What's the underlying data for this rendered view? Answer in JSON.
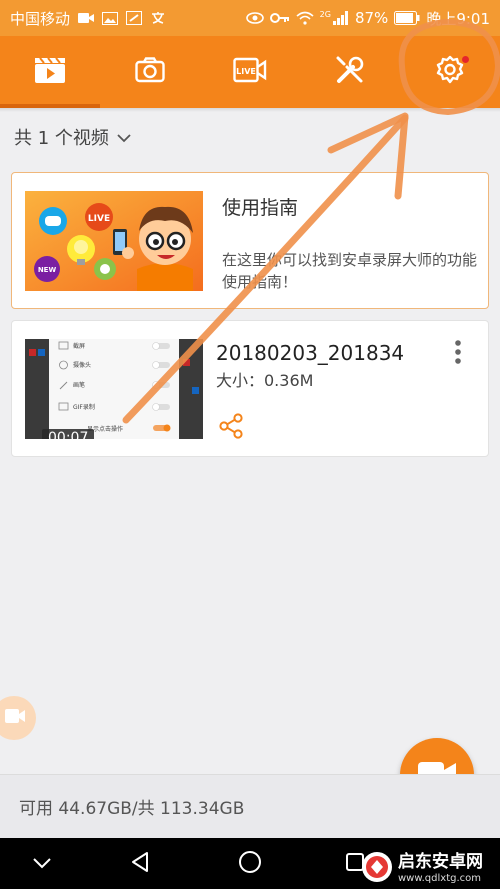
{
  "status_bar": {
    "carrier": "中国移动",
    "network": "2G",
    "battery": "87%",
    "time": "晚上9:01"
  },
  "toolbar": {
    "tabs": [
      {
        "icon": "video-clip-icon",
        "active": true
      },
      {
        "icon": "camera-icon",
        "active": false
      },
      {
        "icon": "live-camera-icon",
        "active": false
      },
      {
        "icon": "tools-icon",
        "active": false
      },
      {
        "icon": "gear-icon",
        "active": false,
        "has_badge": true
      }
    ]
  },
  "filter": {
    "label": "共 1 个视频"
  },
  "guide_card": {
    "title": "使用指南",
    "description": "在这里你可以找到安卓录屏大师的功能使用指南！",
    "banner_badges": [
      "LIVE",
      "NEW"
    ]
  },
  "video_card": {
    "name": "20180203_201834",
    "size": "大小：0.36M",
    "duration": "00:07",
    "thumbnail_rows": [
      "截屏",
      "摄像头",
      "画笔",
      "GIF录制",
      "显示点击操作"
    ]
  },
  "storage": {
    "text": "可用 44.67GB/共 113.34GB"
  },
  "watermark": {
    "title": "启东安卓网",
    "url": "www.qdlxtg.com"
  },
  "colors": {
    "accent": "#f4841a",
    "status_bar": "#f39a32",
    "annotation": "#f0904a"
  }
}
